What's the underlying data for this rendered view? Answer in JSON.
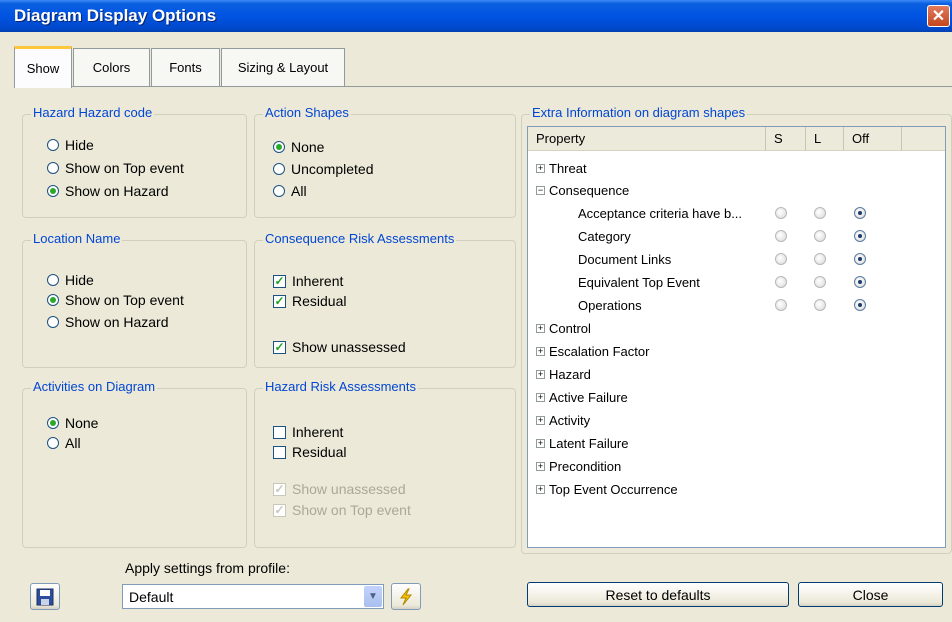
{
  "window": {
    "title": "Diagram Display Options",
    "close_glyph": "✕"
  },
  "tabs": [
    {
      "label": "Show",
      "active": true
    },
    {
      "label": "Colors"
    },
    {
      "label": "Fonts"
    },
    {
      "label": "Sizing & Layout"
    }
  ],
  "groups": {
    "hazard_code": {
      "legend": "Hazard Hazard code",
      "options": [
        "Hide",
        "Show on Top event",
        "Show on Hazard"
      ],
      "selected": 2
    },
    "action_shapes": {
      "legend": "Action Shapes",
      "options": [
        "None",
        "Uncompleted",
        "All"
      ],
      "selected": 0
    },
    "location_name": {
      "legend": "Location Name",
      "options": [
        "Hide",
        "Show on Top event",
        "Show on Hazard"
      ],
      "selected": 1
    },
    "consequence_risk": {
      "legend": "Consequence Risk Assessments",
      "inherent": "Inherent",
      "residual": "Residual",
      "show_unassessed": "Show unassessed",
      "checks": [
        true,
        true,
        true
      ]
    },
    "activities": {
      "legend": "Activities on Diagram",
      "options": [
        "None",
        "All"
      ],
      "selected": 0
    },
    "hazard_risk": {
      "legend": "Hazard Risk Assessments",
      "inherent": "Inherent",
      "residual": "Residual",
      "show_unassessed": "Show unassessed",
      "show_on_top_event": "Show on Top event",
      "checks": [
        false,
        false,
        true,
        true
      ]
    },
    "extra_info": {
      "legend": "Extra Information on diagram shapes"
    }
  },
  "tree": {
    "columns": [
      "Property",
      "S",
      "L",
      "Off"
    ],
    "rows": [
      {
        "label": "Threat",
        "level": 0,
        "expander": "+"
      },
      {
        "label": "Consequence",
        "level": 0,
        "expander": "−"
      },
      {
        "label": "Acceptance criteria have b...",
        "level": 1,
        "selected": "Off"
      },
      {
        "label": "Category",
        "level": 1,
        "selected": "Off"
      },
      {
        "label": "Document Links",
        "level": 1,
        "selected": "Off"
      },
      {
        "label": "Equivalent Top Event",
        "level": 1,
        "selected": "Off"
      },
      {
        "label": "Operations",
        "level": 1,
        "selected": "Off"
      },
      {
        "label": "Control",
        "level": 0,
        "expander": "+"
      },
      {
        "label": "Escalation Factor",
        "level": 0,
        "expander": "+"
      },
      {
        "label": "Hazard",
        "level": 0,
        "expander": "+"
      },
      {
        "label": "Active Failure",
        "level": 0,
        "expander": "+"
      },
      {
        "label": "Activity",
        "level": 0,
        "expander": "+"
      },
      {
        "label": "Latent Failure",
        "level": 0,
        "expander": "+"
      },
      {
        "label": "Precondition",
        "level": 0,
        "expander": "+"
      },
      {
        "label": "Top Event Occurrence",
        "level": 0,
        "expander": "+"
      }
    ]
  },
  "footer": {
    "profile_label": "Apply settings from profile:",
    "profile_value": "Default",
    "save_icon": "floppy-disk-icon",
    "apply_icon": "lightning-icon",
    "reset_label": "Reset to defaults",
    "close_label": "Close"
  },
  "colors": {
    "accent": "#0046d5",
    "title_bar": "#0054e3"
  }
}
